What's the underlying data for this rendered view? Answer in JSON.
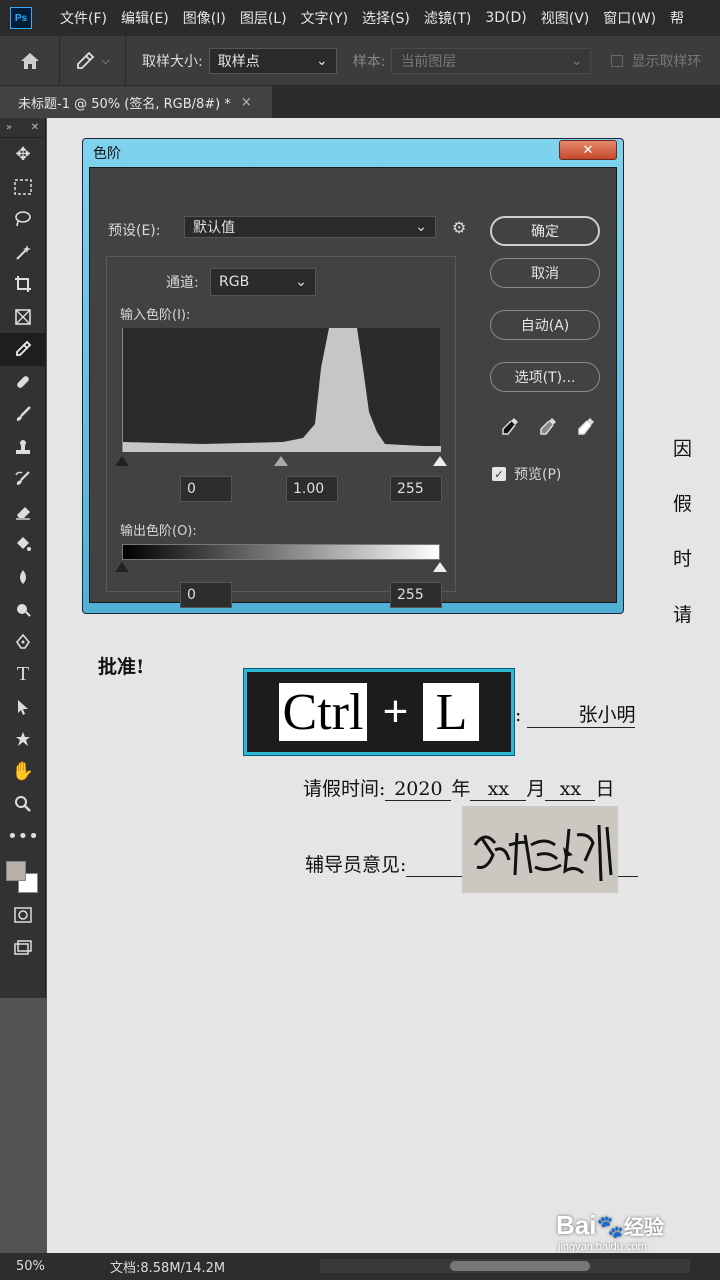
{
  "app": {
    "logo": "Ps"
  },
  "menu": [
    "文件(F)",
    "编辑(E)",
    "图像(I)",
    "图层(L)",
    "文字(Y)",
    "选择(S)",
    "滤镜(T)",
    "3D(D)",
    "视图(V)",
    "窗口(W)",
    "帮"
  ],
  "options": {
    "sample_size_label": "取样大小:",
    "sample_size_value": "取样点",
    "sample_label": "样本:",
    "sample_value": "当前图层",
    "show_ring_label": "显示取样环"
  },
  "document_tab": {
    "title": "未标题-1 @ 50% (签名, RGB/8#) *",
    "close": "×"
  },
  "document": {
    "right_chars": [
      "因",
      "假",
      "时",
      "请"
    ],
    "approve_text": "批准!",
    "name_value": "张小明",
    "leave_time_label": "请假时间:",
    "year_value": "2020",
    "year_unit": "年",
    "month_value": "xx",
    "month_unit": "月",
    "day_value": "xx",
    "day_unit": "日",
    "advisor_label": "辅导员意见:"
  },
  "shortcut": {
    "key1": "Ctrl",
    "plus": "+",
    "key2": "L"
  },
  "dialog": {
    "title": "色阶",
    "close": "✕",
    "preset_label": "预设(E):",
    "preset_value": "默认值",
    "channel_label": "通道:",
    "channel_value": "RGB",
    "input_levels_label": "输入色阶(I):",
    "input_black": "0",
    "input_gamma": "1.00",
    "input_white": "255",
    "output_levels_label": "输出色阶(O):",
    "output_black": "0",
    "output_white": "255",
    "btn_ok": "确定",
    "btn_cancel": "取消",
    "btn_auto": "自动(A)",
    "btn_options": "选项(T)...",
    "preview_label": "预览(P)",
    "preview_checked": true
  },
  "status": {
    "zoom": "50%",
    "doc_info": "文档:8.58M/14.2M",
    "arrow": "❯"
  },
  "watermark": {
    "brand": "Bai",
    "brand2": "经验",
    "url": "jingyan.baidu.com"
  },
  "colors": {
    "accent": "#2fb7d6",
    "foreground": "#b8b0a8",
    "background": "#ffffff"
  }
}
